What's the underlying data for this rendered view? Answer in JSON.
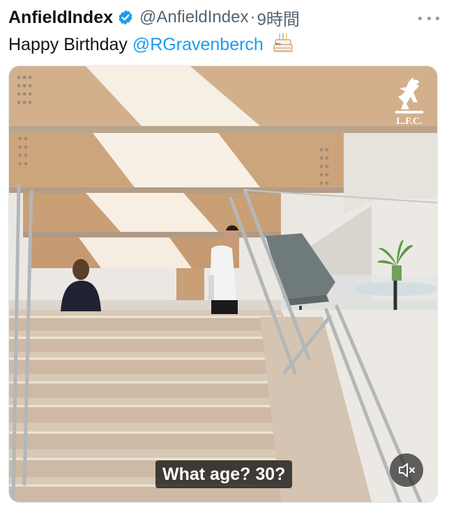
{
  "tweet": {
    "display_name": "AnfieldIndex",
    "handle": "@AnfieldIndex",
    "separator": "·",
    "time": "9時間",
    "text_prefix": "Happy Birthday ",
    "mention": "@RGravenberch",
    "emoji_icon": "birthday-cake-icon",
    "verified_icon": "verified-badge-icon",
    "more_icon": "more-options-icon"
  },
  "media": {
    "subtitle": "What age? 30?",
    "logo_text": "L.F.C.",
    "volume_icon": "volume-muted-icon"
  },
  "colors": {
    "mention": "#1d9bf0",
    "verified": "#1d9bf0",
    "secondary_text": "#536471"
  }
}
